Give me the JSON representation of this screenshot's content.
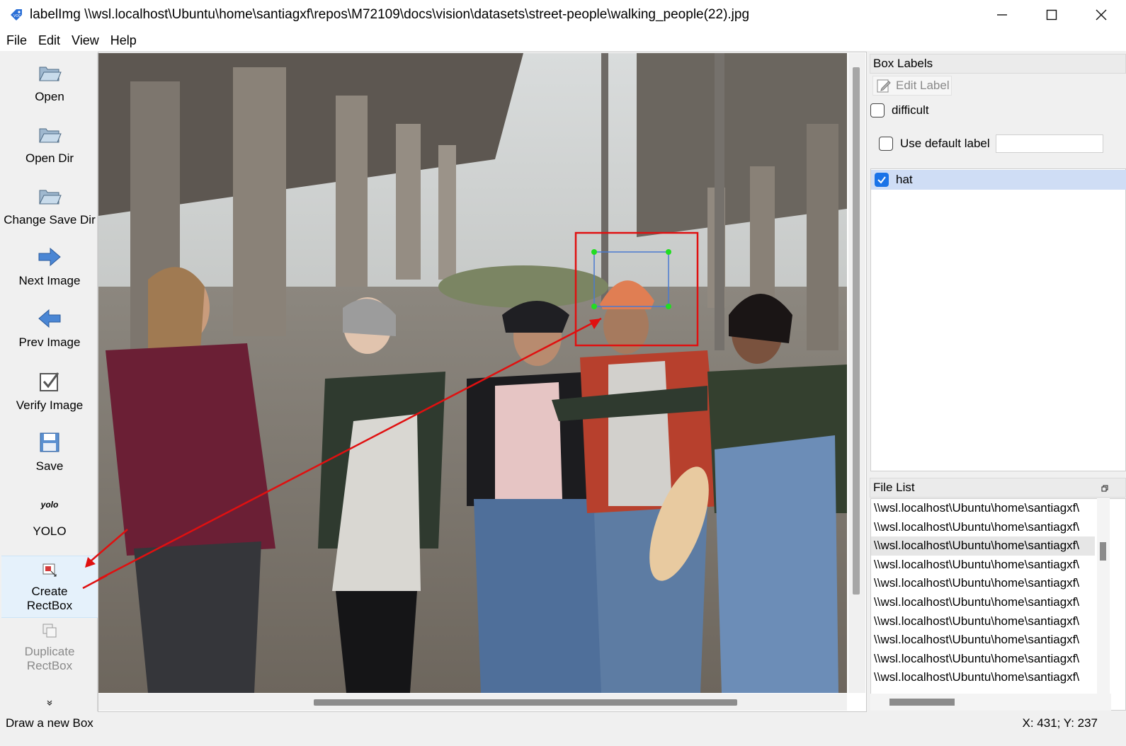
{
  "window": {
    "title": "labelImg \\\\wsl.localhost\\Ubuntu\\home\\santiagxf\\repos\\M72109\\docs\\vision\\datasets\\street-people\\walking_people(22).jpg",
    "minimize_icon": "minimize-icon",
    "maximize_icon": "maximize-icon",
    "close_icon": "close-icon"
  },
  "menu": [
    "File",
    "Edit",
    "View",
    "Help"
  ],
  "toolbar": {
    "open": "Open",
    "open_dir": "Open Dir",
    "change_save_dir": "Change Save Dir",
    "next_image": "Next Image",
    "prev_image": "Prev Image",
    "verify_image": "Verify Image",
    "save": "Save",
    "yolo_icon_text": "yolo",
    "yolo": "YOLO",
    "create_rectbox_1": "Create",
    "create_rectbox_2": "RectBox",
    "duplicate_rectbox_1": "Duplicate",
    "duplicate_rectbox_2": "RectBox",
    "more_icon": "chevron-double-down-icon"
  },
  "box_labels": {
    "title": "Box Labels",
    "edit_label": "Edit Label",
    "difficult": "difficult",
    "use_default_label": "Use default label",
    "default_label_value": "",
    "labels": [
      {
        "name": "hat",
        "checked": true
      }
    ]
  },
  "file_list": {
    "title": "File List",
    "items": [
      "\\\\wsl.localhost\\Ubuntu\\home\\santiagxf\\",
      "\\\\wsl.localhost\\Ubuntu\\home\\santiagxf\\",
      "\\\\wsl.localhost\\Ubuntu\\home\\santiagxf\\",
      "\\\\wsl.localhost\\Ubuntu\\home\\santiagxf\\",
      "\\\\wsl.localhost\\Ubuntu\\home\\santiagxf\\",
      "\\\\wsl.localhost\\Ubuntu\\home\\santiagxf\\",
      "\\\\wsl.localhost\\Ubuntu\\home\\santiagxf\\",
      "\\\\wsl.localhost\\Ubuntu\\home\\santiagxf\\",
      "\\\\wsl.localhost\\Ubuntu\\home\\santiagxf\\",
      "\\\\wsl.localhost\\Ubuntu\\home\\santiagxf\\"
    ],
    "selected_index": 2
  },
  "status": {
    "message": "Draw a new Box",
    "coords": "X: 431; Y: 237"
  },
  "colors": {
    "accent": "#1a73e8",
    "annotation_red": "#e01010",
    "bbox_green": "#22dd22",
    "bbox_blue": "#4a7ad0"
  }
}
